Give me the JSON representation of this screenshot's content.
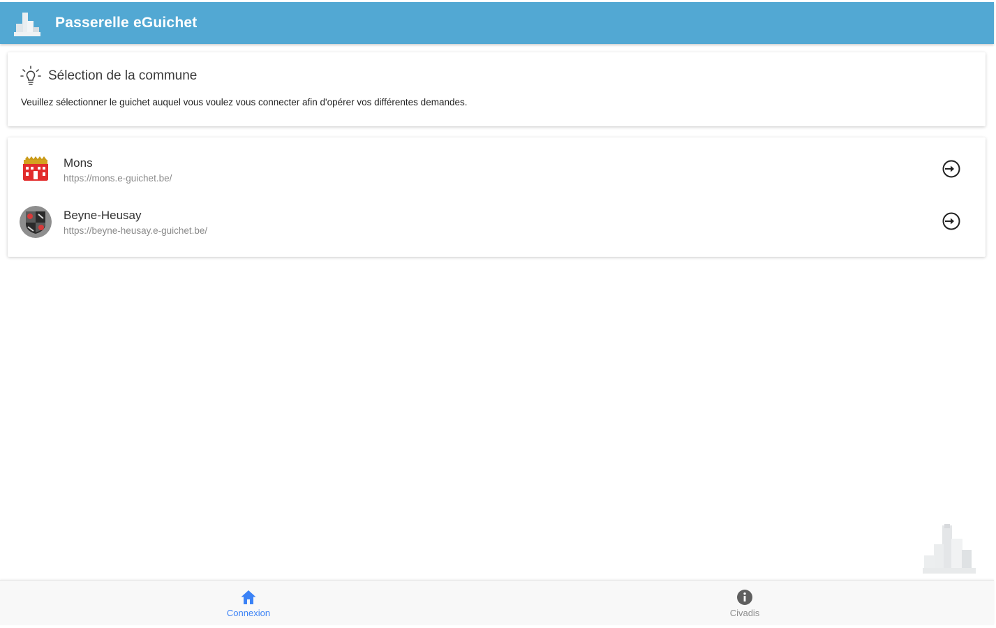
{
  "app": {
    "title": "Passerelle eGuichet"
  },
  "info_card": {
    "title": "Sélection de la commune",
    "text": "Veuillez sélectionner le guichet auquel vous voulez vous connecter afin d'opérer vos différentes demandes.",
    "icon": "lightbulb-icon"
  },
  "communes": [
    {
      "name": "Mons",
      "url": "https://mons.e-guichet.be/",
      "icon": "mons-coat-of-arms"
    },
    {
      "name": "Beyne-Heusay",
      "url": "https://beyne-heusay.e-guichet.be/",
      "icon": "beyne-heusay-coat-of-arms"
    }
  ],
  "tabs": [
    {
      "label": "Connexion",
      "icon": "home-icon",
      "active": true
    },
    {
      "label": "Civadis",
      "icon": "info-icon",
      "active": false
    }
  ],
  "colors": {
    "appbar": "#52a8d3",
    "tab_active": "#3b82f6",
    "tab_inactive": "#8c8c8c"
  }
}
